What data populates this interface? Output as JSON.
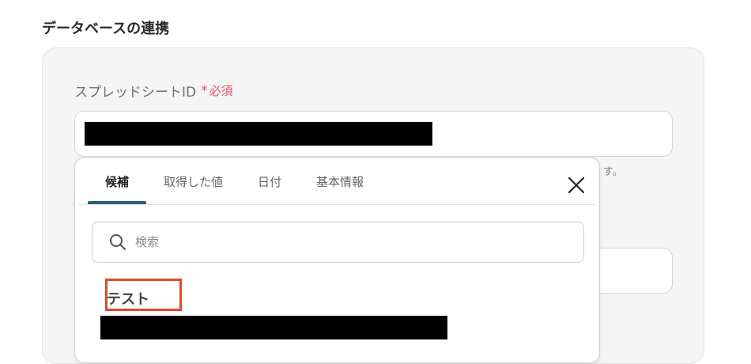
{
  "section": {
    "title": "データベースの連携"
  },
  "field": {
    "label": "スプレッドシートID",
    "required_mark": "*",
    "required_text": "必須",
    "helper_tail": "す。"
  },
  "popover": {
    "tabs": [
      {
        "label": "候補",
        "active": true
      },
      {
        "label": "取得した値",
        "active": false
      },
      {
        "label": "日付",
        "active": false
      },
      {
        "label": "基本情報",
        "active": false
      }
    ],
    "search": {
      "placeholder": "検索",
      "value": ""
    },
    "options": [
      {
        "title": "テスト"
      }
    ]
  },
  "colors": {
    "accent": "#2f5f6e",
    "required": "#e0506a",
    "highlight": "#e04a2c"
  }
}
